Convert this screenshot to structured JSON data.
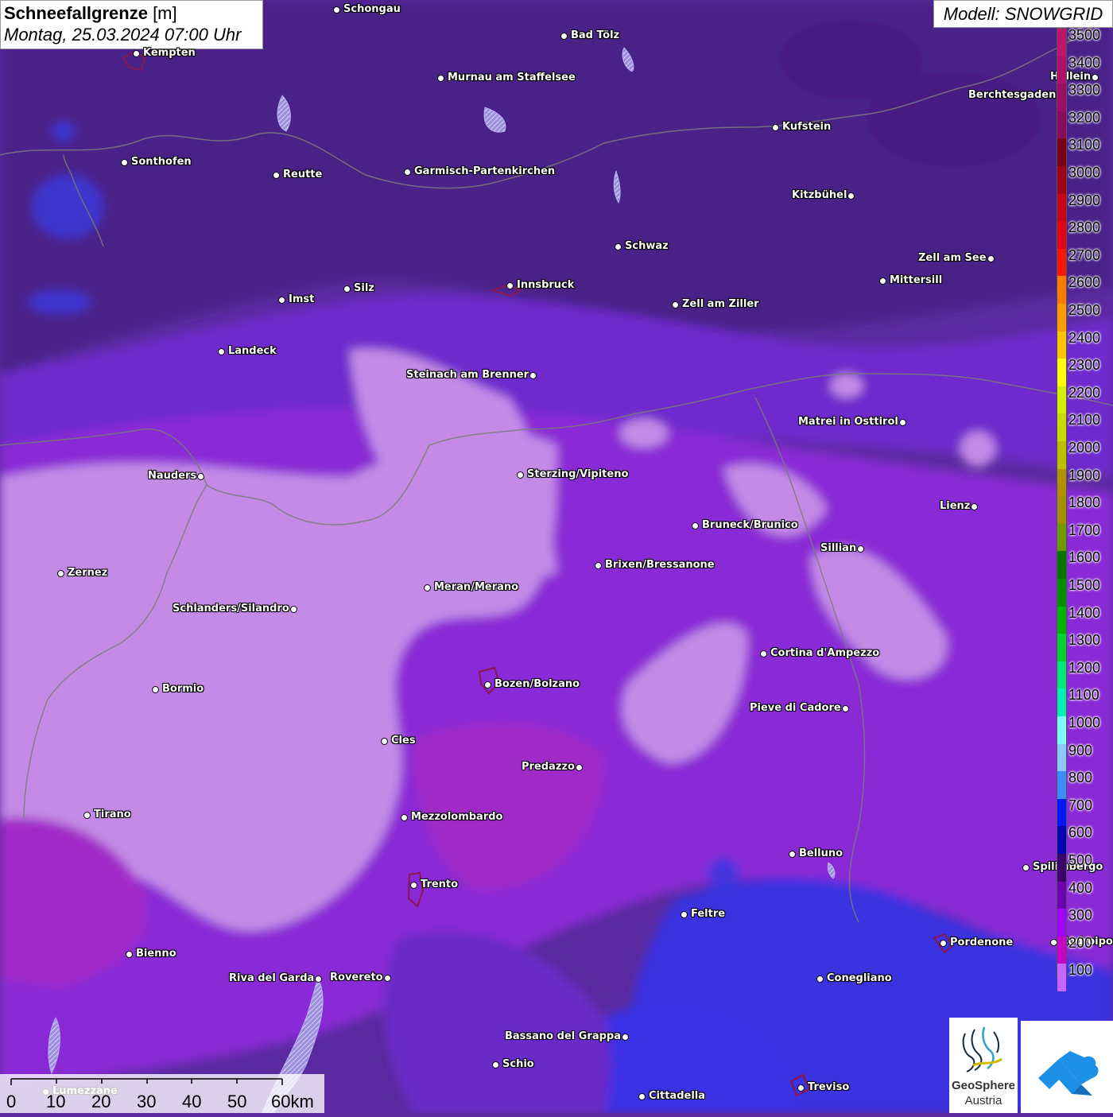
{
  "header": {
    "title_bold": "Schneefallgrenze",
    "title_unit": " [m]",
    "datetime": "Montag, 25.03.2024 07:00 Uhr",
    "model": "Modell: SNOWGRID"
  },
  "legend": {
    "levels": [
      {
        "label": "3500",
        "color": "#c2136e"
      },
      {
        "label": "3400",
        "color": "#b0106a"
      },
      {
        "label": "3300",
        "color": "#9e0d64"
      },
      {
        "label": "3200",
        "color": "#8a0b5c"
      },
      {
        "label": "3100",
        "color": "#7a0019"
      },
      {
        "label": "3000",
        "color": "#a3001c"
      },
      {
        "label": "2900",
        "color": "#cc0018"
      },
      {
        "label": "2800",
        "color": "#e60014"
      },
      {
        "label": "2700",
        "color": "#ff1500"
      },
      {
        "label": "2600",
        "color": "#ff7a00"
      },
      {
        "label": "2500",
        "color": "#ff9c00"
      },
      {
        "label": "2400",
        "color": "#ffc400"
      },
      {
        "label": "2300",
        "color": "#ffff00"
      },
      {
        "label": "2200",
        "color": "#d4f000"
      },
      {
        "label": "2100",
        "color": "#c8dc00"
      },
      {
        "label": "2000",
        "color": "#bfbf00"
      },
      {
        "label": "1900",
        "color": "#b49100"
      },
      {
        "label": "1800",
        "color": "#a19100"
      },
      {
        "label": "1700",
        "color": "#6e9a00"
      },
      {
        "label": "1600",
        "color": "#007800"
      },
      {
        "label": "1500",
        "color": "#009000"
      },
      {
        "label": "1400",
        "color": "#00b400"
      },
      {
        "label": "1300",
        "color": "#00d232"
      },
      {
        "label": "1200",
        "color": "#00e678"
      },
      {
        "label": "1100",
        "color": "#00f0b4"
      },
      {
        "label": "1000",
        "color": "#7dfcff"
      },
      {
        "label": "900",
        "color": "#8cc8ff"
      },
      {
        "label": "800",
        "color": "#3c8cff"
      },
      {
        "label": "700",
        "color": "#0014ff"
      },
      {
        "label": "600",
        "color": "#0000b4"
      },
      {
        "label": "500",
        "color": "#3c006e"
      },
      {
        "label": "400",
        "color": "#6e00b4"
      },
      {
        "label": "300",
        "color": "#a000ff"
      },
      {
        "label": "200",
        "color": "#c800c8"
      },
      {
        "label": "100",
        "color": "#c864ff"
      }
    ]
  },
  "places": [
    {
      "name": "Schongau"
    },
    {
      "name": "Bad Tölz"
    },
    {
      "name": "Kempten"
    },
    {
      "name": "Murnau am Staffelsee"
    },
    {
      "name": "Hallein"
    },
    {
      "name": "Berchtesgaden"
    },
    {
      "name": "Kufstein"
    },
    {
      "name": "Sonthofen"
    },
    {
      "name": "Reutte"
    },
    {
      "name": "Garmisch-Partenkirchen"
    },
    {
      "name": "Kitzbühel"
    },
    {
      "name": "Schwaz"
    },
    {
      "name": "Zell am See"
    },
    {
      "name": "Mittersill"
    },
    {
      "name": "Innsbruck"
    },
    {
      "name": "Imst"
    },
    {
      "name": "Silz"
    },
    {
      "name": "Zell am Ziller"
    },
    {
      "name": "Landeck"
    },
    {
      "name": "Steinach am Brenner"
    },
    {
      "name": "Matrei in Osttirol"
    },
    {
      "name": "Nauders"
    },
    {
      "name": "Sterzing/Vipiteno"
    },
    {
      "name": "Lienz"
    },
    {
      "name": "Bruneck/Brunico"
    },
    {
      "name": "Sillian"
    },
    {
      "name": "Zernez"
    },
    {
      "name": "Brixen/Bressanone"
    },
    {
      "name": "Meran/Merano"
    },
    {
      "name": "Schlanders/Silandro"
    },
    {
      "name": "Cortina d'Ampezzo"
    },
    {
      "name": "Bormio"
    },
    {
      "name": "Bozen/Bolzano"
    },
    {
      "name": "Pieve di Cadore"
    },
    {
      "name": "Cles"
    },
    {
      "name": "Predazzo"
    },
    {
      "name": "Tirano"
    },
    {
      "name": "Mezzolombardo"
    },
    {
      "name": "Belluno"
    },
    {
      "name": "Spilimbergo"
    },
    {
      "name": "Trento"
    },
    {
      "name": "Feltre"
    },
    {
      "name": "Pordenone"
    },
    {
      "name": "Codroipo"
    },
    {
      "name": "Bienno"
    },
    {
      "name": "Riva del Garda"
    },
    {
      "name": "Rovereto"
    },
    {
      "name": "Conegliano"
    },
    {
      "name": "Bassano del Grappa"
    },
    {
      "name": "Schio"
    },
    {
      "name": "Cittadella"
    },
    {
      "name": "Treviso"
    },
    {
      "name": "Lumezzane"
    }
  ],
  "scale": {
    "ticks": [
      "0",
      "10",
      "20",
      "30",
      "40",
      "50",
      "60km"
    ]
  },
  "logos": {
    "geosphere_line1": "GeoSphere",
    "geosphere_line2": "Austria"
  },
  "colors": {
    "map_dark_purple": "#4e2590",
    "map_mid_purple": "#7a2ad8",
    "map_light_lilac": "#c98ae8",
    "map_magenta": "#a626c4",
    "map_blue": "#3030e0",
    "label_text": "#ffffff",
    "label_outline": "#000000"
  }
}
